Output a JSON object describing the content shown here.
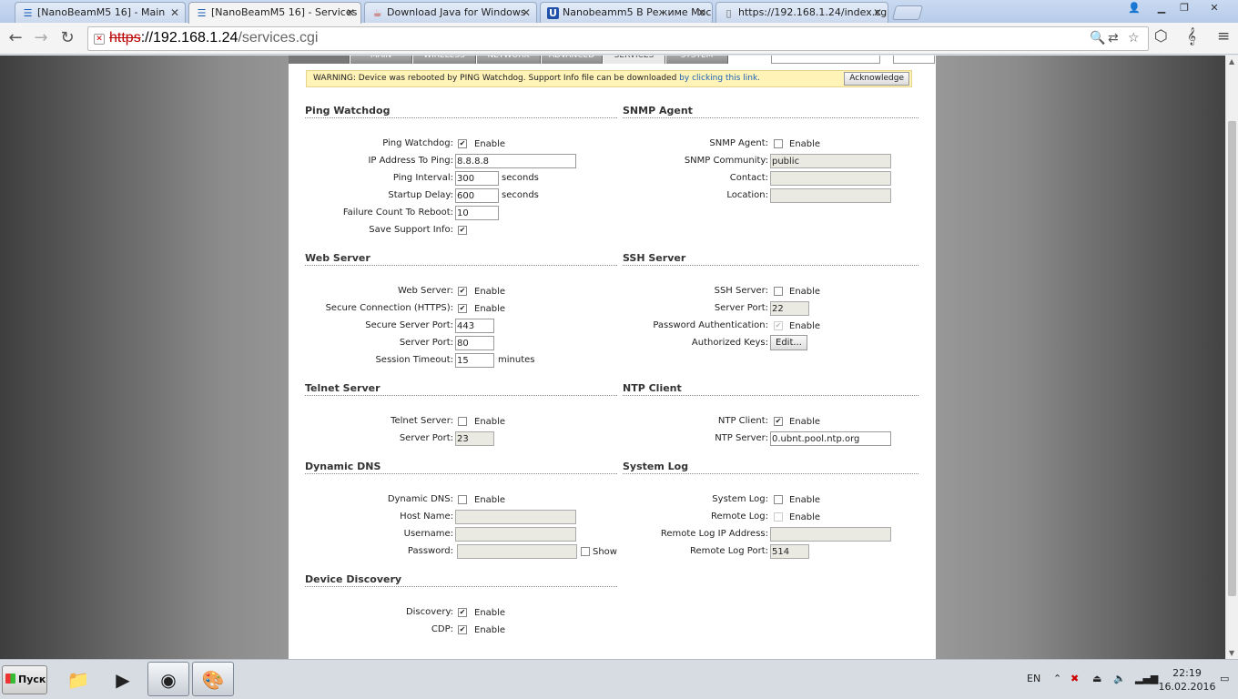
{
  "browser": {
    "tabs": [
      {
        "title": "[NanoBeamM5 16] - Main",
        "icon": "rss-icon",
        "active": false
      },
      {
        "title": "[NanoBeamM5 16] - Services",
        "icon": "rss-icon",
        "active": true
      },
      {
        "title": "Download Java for Windows",
        "icon": "java-icon",
        "active": false
      },
      {
        "title": "Nanobeamm5 В Режиме Мос",
        "icon": "ubiquiti-icon",
        "active": false
      },
      {
        "title": "https://192.168.1.24/index.cgi",
        "icon": "page-icon",
        "active": false
      }
    ],
    "url_scheme": "https",
    "url_host": "://192.168.1.24",
    "url_path": "/services.cgi"
  },
  "app": {
    "nav_tabs": [
      "MAIN",
      "WIRELESS",
      "NETWORK",
      "ADVANCED",
      "SERVICES",
      "SYSTEM"
    ],
    "active_nav": "SERVICES",
    "warning_text": "WARNING: Device was rebooted by PING Watchdog. Support Info file can be downloaded ",
    "warning_link": "by clicking this link.",
    "ack_label": "Acknowledge",
    "enable_label": "Enable",
    "ping": {
      "title": "Ping Watchdog",
      "watchdog_label": "Ping Watchdog:",
      "watchdog_checked": true,
      "ip_label": "IP Address To Ping:",
      "ip_value": "8.8.8.8",
      "interval_label": "Ping Interval:",
      "interval_value": "300",
      "interval_unit": "seconds",
      "delay_label": "Startup Delay:",
      "delay_value": "600",
      "delay_unit": "seconds",
      "failure_label": "Failure Count To Reboot:",
      "failure_value": "10",
      "support_label": "Save Support Info:",
      "support_checked": true
    },
    "snmp": {
      "title": "SNMP Agent",
      "agent_label": "SNMP Agent:",
      "agent_checked": false,
      "community_label": "SNMP Community:",
      "community_value": "public",
      "contact_label": "Contact:",
      "contact_value": "",
      "location_label": "Location:",
      "location_value": ""
    },
    "web": {
      "title": "Web Server",
      "server_label": "Web Server:",
      "server_checked": true,
      "https_label": "Secure Connection (HTTPS):",
      "https_checked": true,
      "secure_port_label": "Secure Server Port:",
      "secure_port_value": "443",
      "port_label": "Server Port:",
      "port_value": "80",
      "timeout_label": "Session Timeout:",
      "timeout_value": "15",
      "timeout_unit": "minutes"
    },
    "ssh": {
      "title": "SSH Server",
      "server_label": "SSH Server:",
      "server_checked": false,
      "port_label": "Server Port:",
      "port_value": "22",
      "pw_auth_label": "Password Authentication:",
      "pw_auth_checked": true,
      "keys_label": "Authorized Keys:",
      "keys_button": "Edit..."
    },
    "telnet": {
      "title": "Telnet Server",
      "server_label": "Telnet Server:",
      "server_checked": false,
      "port_label": "Server Port:",
      "port_value": "23"
    },
    "ntp": {
      "title": "NTP Client",
      "client_label": "NTP Client:",
      "client_checked": true,
      "server_label": "NTP Server:",
      "server_value": "0.ubnt.pool.ntp.org"
    },
    "ddns": {
      "title": "Dynamic DNS",
      "ddns_label": "Dynamic DNS:",
      "ddns_checked": false,
      "host_label": "Host Name:",
      "host_value": "",
      "user_label": "Username:",
      "user_value": "",
      "pass_label": "Password:",
      "pass_value": "",
      "show_label": "Show"
    },
    "syslog": {
      "title": "System Log",
      "log_label": "System Log:",
      "log_checked": false,
      "remote_label": "Remote Log:",
      "remote_checked": false,
      "remote_ip_label": "Remote Log IP Address:",
      "remote_ip_value": "",
      "remote_port_label": "Remote Log Port:",
      "remote_port_value": "514"
    },
    "discovery": {
      "title": "Device Discovery",
      "discovery_label": "Discovery:",
      "discovery_checked": true,
      "cdp_label": "CDP:",
      "cdp_checked": true
    }
  },
  "taskbar": {
    "start_label": "Пуск",
    "lang": "EN",
    "time": "22:19",
    "date": "16.02.2016"
  }
}
